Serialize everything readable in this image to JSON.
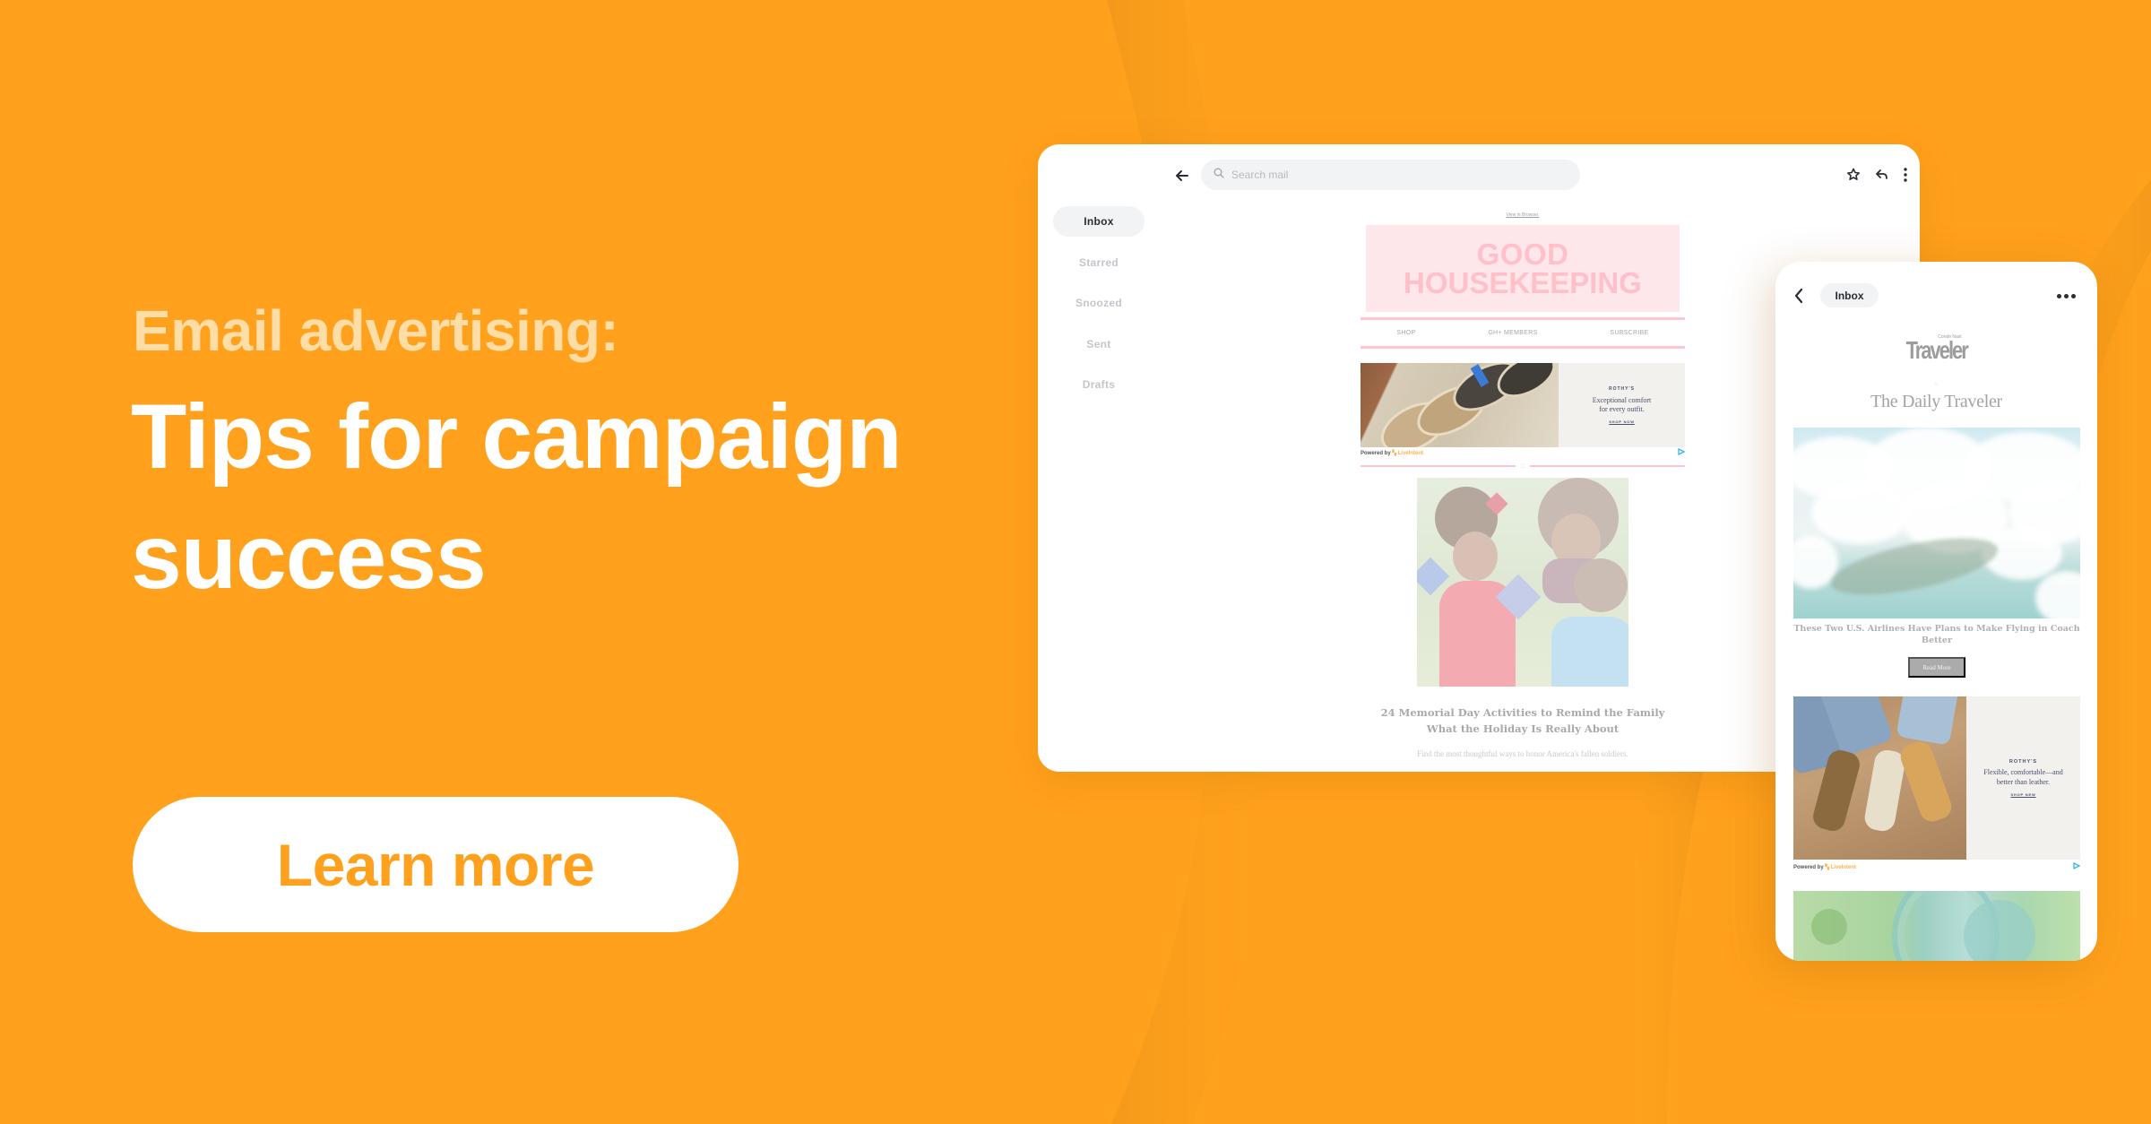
{
  "colors": {
    "background": "#FFA11C",
    "eyebrow": "#FFDDA6",
    "headline": "#FFFFFF",
    "cta_bg": "#FFFFFF",
    "cta_text": "#FFA11C"
  },
  "hero": {
    "eyebrow": "Email advertising:",
    "headline": "Tips for campaign success",
    "cta_label": "Learn more"
  },
  "desktop": {
    "search_placeholder": "Search mail",
    "icons": [
      "back-arrow-icon",
      "search-icon",
      "star-icon",
      "reply-icon",
      "more-vertical-icon"
    ],
    "sidebar": [
      {
        "label": "Inbox",
        "active": true
      },
      {
        "label": "Starred",
        "active": false
      },
      {
        "label": "Snoozed",
        "active": false
      },
      {
        "label": "Sent",
        "active": false
      },
      {
        "label": "Drafts",
        "active": false
      }
    ],
    "email": {
      "view_in_browser": "View in Browser.",
      "brand_line1": "GOOD",
      "brand_line2": "HOUSEKEEPING",
      "nav": [
        "SHOP",
        "GH+ MEMBERS",
        "SUBSCRIBE"
      ],
      "ad": {
        "brand": "ROTHY'S",
        "text_line1": "Exceptional comfort",
        "text_line2": "for every outfit.",
        "cta": "SHOP NOW"
      },
      "powered_by": "Powered by",
      "powered_brand": "LiveIntent",
      "article_title_line1": "24 Memorial Day Activities to Remind the Family",
      "article_title_line2": "What the Holiday Is Really About",
      "article_sub": "Find the most thoughtful ways to honor America's fallen soldiers."
    }
  },
  "phone": {
    "inbox_label": "Inbox",
    "logo_small": "Condé Nast",
    "logo_big": "Traveler",
    "newsletter_title": "The Daily Traveler",
    "article_caption": "These Two U.S. Airlines Have Plans to Make Flying in Coach Better",
    "read_more": "Read More",
    "ad": {
      "brand": "ROTHY'S",
      "text_line1": "Flexible, comfortable—and",
      "text_line2": "better than leather.",
      "cta": "SHOP NEW"
    },
    "powered_by": "Powered by",
    "powered_brand": "LiveIntent"
  }
}
